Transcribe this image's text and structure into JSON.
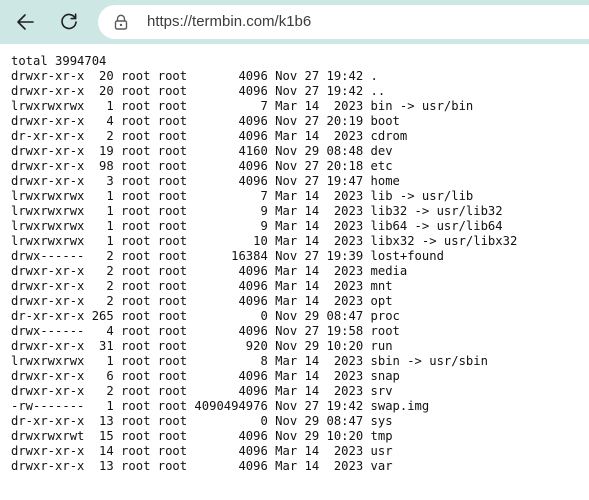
{
  "browser": {
    "url": "https://termbin.com/k1b6",
    "back_icon": "arrow-left-icon",
    "refresh_icon": "refresh-icon",
    "lock_icon": "lock-icon",
    "toolbar_color": "#cde7e4"
  },
  "listing": {
    "total": "total 3994704",
    "lines": [
      "drwxr-xr-x  20 root root       4096 Nov 27 19:42 .",
      "drwxr-xr-x  20 root root       4096 Nov 27 19:42 ..",
      "lrwxrwxrwx   1 root root          7 Mar 14  2023 bin -> usr/bin",
      "drwxr-xr-x   4 root root       4096 Nov 27 20:19 boot",
      "dr-xr-xr-x   2 root root       4096 Mar 14  2023 cdrom",
      "drwxr-xr-x  19 root root       4160 Nov 29 08:48 dev",
      "drwxr-xr-x  98 root root       4096 Nov 27 20:18 etc",
      "drwxr-xr-x   3 root root       4096 Nov 27 19:47 home",
      "lrwxrwxrwx   1 root root          7 Mar 14  2023 lib -> usr/lib",
      "lrwxrwxrwx   1 root root          9 Mar 14  2023 lib32 -> usr/lib32",
      "lrwxrwxrwx   1 root root          9 Mar 14  2023 lib64 -> usr/lib64",
      "lrwxrwxrwx   1 root root         10 Mar 14  2023 libx32 -> usr/libx32",
      "drwx------   2 root root      16384 Nov 27 19:39 lost+found",
      "drwxr-xr-x   2 root root       4096 Mar 14  2023 media",
      "drwxr-xr-x   2 root root       4096 Mar 14  2023 mnt",
      "drwxr-xr-x   2 root root       4096 Mar 14  2023 opt",
      "dr-xr-xr-x 265 root root          0 Nov 29 08:47 proc",
      "drwx------   4 root root       4096 Nov 27 19:58 root",
      "drwxr-xr-x  31 root root        920 Nov 29 10:20 run",
      "lrwxrwxrwx   1 root root          8 Mar 14  2023 sbin -> usr/sbin",
      "drwxr-xr-x   6 root root       4096 Mar 14  2023 snap",
      "drwxr-xr-x   2 root root       4096 Mar 14  2023 srv",
      "-rw-------   1 root root 4090494976 Nov 27 19:42 swap.img",
      "dr-xr-xr-x  13 root root          0 Nov 29 08:47 sys",
      "drwxrwxrwt  15 root root       4096 Nov 29 10:20 tmp",
      "drwxr-xr-x  14 root root       4096 Mar 14  2023 usr",
      "drwxr-xr-x  13 root root       4096 Mar 14  2023 var"
    ]
  }
}
